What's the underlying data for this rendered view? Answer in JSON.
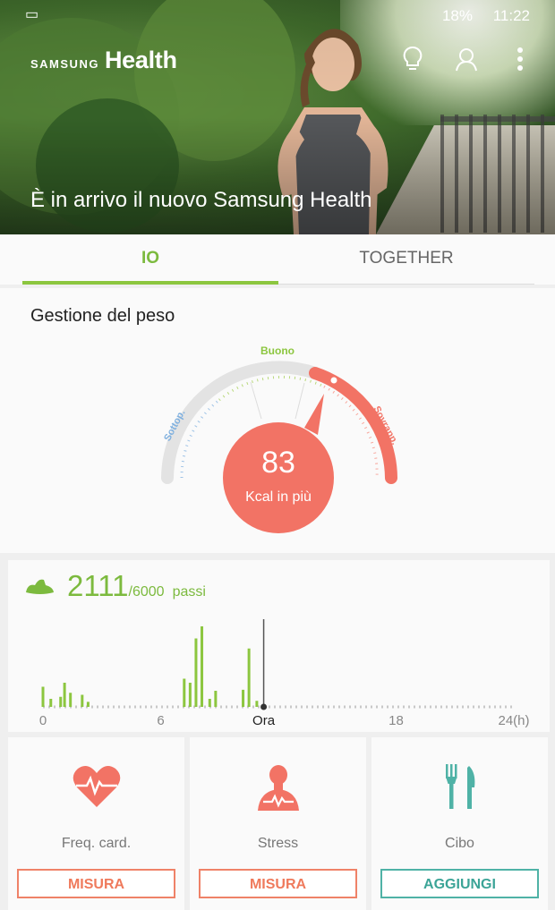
{
  "statusbar": {
    "time": "11:22",
    "battery": "18%"
  },
  "header": {
    "brand_small": "SAMSUNG",
    "brand_big": "Health",
    "hero_title": "È in arrivo il nuovo Samsung Health"
  },
  "tabs": [
    {
      "label": "IO",
      "active": true
    },
    {
      "label": "TOGETHER",
      "active": false
    }
  ],
  "weight": {
    "title": "Gestione del peso",
    "zones": [
      "Sottop.",
      "Buono",
      "Sovrapp."
    ],
    "value": "83",
    "unit": "Kcal in più",
    "level": 0.74
  },
  "steps": {
    "count": "2111",
    "goal": "/6000",
    "unit": "passi",
    "axis_labels": [
      "0",
      "6",
      "Ora",
      "18",
      "24(h)"
    ],
    "now_hour": 11.25,
    "hourly": [
      {
        "h": 0.0,
        "v": 20
      },
      {
        "h": 0.4,
        "v": 8
      },
      {
        "h": 0.9,
        "v": 10
      },
      {
        "h": 1.1,
        "v": 24
      },
      {
        "h": 1.4,
        "v": 14
      },
      {
        "h": 2.0,
        "v": 12
      },
      {
        "h": 2.3,
        "v": 5
      },
      {
        "h": 7.2,
        "v": 28
      },
      {
        "h": 7.5,
        "v": 24
      },
      {
        "h": 7.8,
        "v": 68
      },
      {
        "h": 8.1,
        "v": 80
      },
      {
        "h": 8.5,
        "v": 8
      },
      {
        "h": 8.8,
        "v": 16
      },
      {
        "h": 10.2,
        "v": 17
      },
      {
        "h": 10.5,
        "v": 58
      },
      {
        "h": 10.9,
        "v": 6
      }
    ]
  },
  "cards": [
    {
      "label": "Freq. card.",
      "button": "MISURA",
      "icon": "heart-rate-icon"
    },
    {
      "label": "Stress",
      "button": "MISURA",
      "icon": "stress-icon"
    },
    {
      "label": "Cibo",
      "button": "AGGIUNGI",
      "icon": "food-icon"
    }
  ],
  "colors": {
    "green": "#8cc63f",
    "coral": "#f27365",
    "teal": "#4fb2a6"
  }
}
